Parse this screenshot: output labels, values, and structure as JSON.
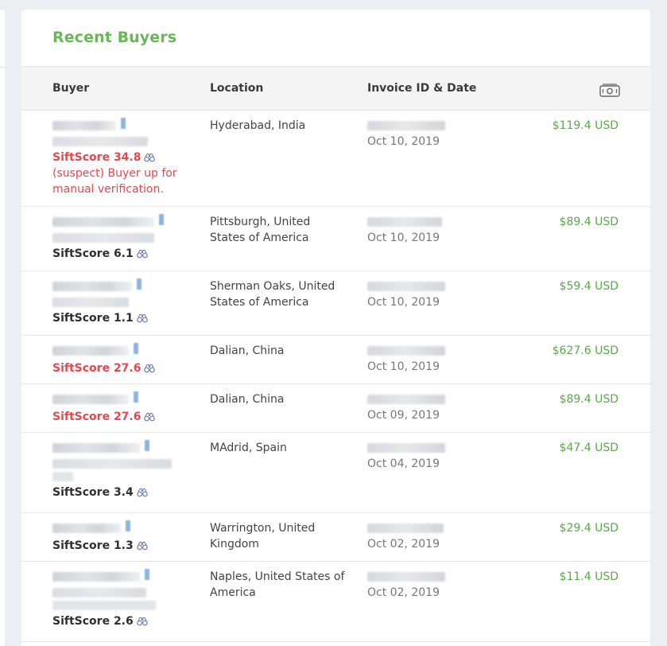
{
  "card": {
    "title": "Recent Buyers"
  },
  "table": {
    "headers": {
      "buyer": "Buyer",
      "location": "Location",
      "invoice": "Invoice ID & Date",
      "amount_icon": "money-icon"
    },
    "rows": [
      {
        "location": "Hyderabad, India",
        "date": "Oct 10, 2019",
        "amount": "$119.4 USD",
        "sift": "SiftScore 34.8",
        "sift_level": "high",
        "note": "(suspect) Buyer up for manual verification."
      },
      {
        "location": "Pittsburgh, United States of America",
        "date": "Oct 10, 2019",
        "amount": "$89.4 USD",
        "sift": "SiftScore 6.1",
        "sift_level": "low"
      },
      {
        "location": "Sherman Oaks, United States of America",
        "date": "Oct 10, 2019",
        "amount": "$59.4 USD",
        "sift": "SiftScore 1.1",
        "sift_level": "low"
      },
      {
        "location": "Dalian, China",
        "date": "Oct 10, 2019",
        "amount": "$627.6 USD",
        "sift": "SiftScore 27.6",
        "sift_level": "high"
      },
      {
        "location": "Dalian, China",
        "date": "Oct 09, 2019",
        "amount": "$89.4 USD",
        "sift": "SiftScore 27.6",
        "sift_level": "high"
      },
      {
        "location": "MAdrid, Spain",
        "date": "Oct 04, 2019",
        "amount": "$47.4 USD",
        "sift": "SiftScore 3.4",
        "sift_level": "low"
      },
      {
        "location": "Warrington, United Kingdom",
        "date": "Oct 02, 2019",
        "amount": "$29.4 USD",
        "sift": "SiftScore 1.3",
        "sift_level": "low"
      },
      {
        "location": "Naples, United States of America",
        "date": "Oct 02, 2019",
        "amount": "$11.4 USD",
        "sift": "SiftScore 2.6",
        "sift_level": "low"
      }
    ]
  },
  "colors": {
    "title": "#6bb55b",
    "amount": "#5aa84a",
    "sift_high": "#e5484d",
    "sift_low": "#2f2f2f",
    "icon": "binoculars-icon"
  }
}
